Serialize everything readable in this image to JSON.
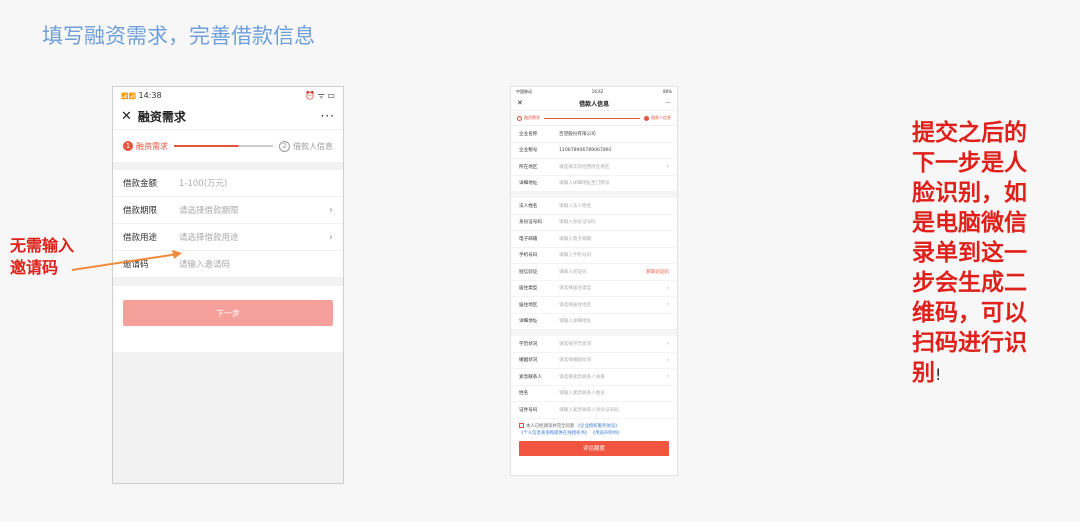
{
  "slide": {
    "title": "填写融资需求，完善借款信息"
  },
  "phone1": {
    "status": {
      "signal": "📶📶",
      "time": "14:38",
      "icons": "⏰ ᯤ ▭"
    },
    "nav": {
      "close": "✕",
      "title": "融资需求",
      "more": "···"
    },
    "steps": {
      "step1_num": "1",
      "step1_label": "融资需求",
      "step2_num": "2",
      "step2_label": "借款人信息"
    },
    "fields": [
      {
        "label": "借款金额",
        "value": "1-100(万元)"
      },
      {
        "label": "借款期限",
        "value": "请选择借款期限"
      },
      {
        "label": "借款用途",
        "value": "请选择借款用途"
      },
      {
        "label": "邀请码",
        "value": "请输入邀请码"
      }
    ],
    "chevron": "›",
    "next_button": "下一步"
  },
  "annotation_left": {
    "line1": "无需输入",
    "line2": "邀请码"
  },
  "phone2": {
    "status": {
      "carrier": "中国移动",
      "time": "16:42",
      "battery": "86%"
    },
    "nav": {
      "close": "✕",
      "title": "借款人信息",
      "more": "···"
    },
    "steps": {
      "step1": "融资需求",
      "step2": "借款人信息"
    },
    "group1": [
      {
        "label": "企业名称",
        "value": "百望股份有限公司"
      },
      {
        "label": "企业税号",
        "value": "110678906789067891"
      },
      {
        "label": "所在地区",
        "value": "请选择实际经营所在地区"
      },
      {
        "label": "详细地址",
        "value": "请输入详细地址至门牌号"
      }
    ],
    "group2": [
      {
        "label": "法人姓名",
        "value": "请输入法人姓名"
      },
      {
        "label": "身份证号码",
        "value": "请输入身份证号码"
      },
      {
        "label": "电子邮箱",
        "value": "请输入电子邮箱"
      },
      {
        "label": "手机号码",
        "value": "请输入手机号码"
      },
      {
        "label": "短信验证",
        "value": "请输入验证码",
        "action": "获取验证码"
      },
      {
        "label": "居住类型",
        "value": "请选择居住类型"
      },
      {
        "label": "居住地区",
        "value": "请选择居住地区"
      },
      {
        "label": "详细地址",
        "value": "请输入详细地址"
      }
    ],
    "group3": [
      {
        "label": "学历状况",
        "value": "请选择学历状况"
      },
      {
        "label": "婚姻状况",
        "value": "请选择婚姻状况"
      },
      {
        "label": "紧急联系人",
        "value": "请选择紧急联系人关系"
      },
      {
        "label": "姓名",
        "value": "请输入紧急联系人姓名"
      },
      {
        "label": "证件号码",
        "value": "请输入紧急联系人身份证号码"
      }
    ],
    "agreement": {
      "prefix": "本人已经阅读并完全同意",
      "link1": "《企业授权服务协议》",
      "link2": "《个人信息查询和提供在线授权书》",
      "link3": "《用途声明书》"
    },
    "submit_button": "评估额度",
    "chevron": "›"
  },
  "annotation_right": {
    "text": "提交之后的下一步是人脸识别，如是电脑微信录单到这一步会生成二维码，可以扫码进行识别",
    "end": "!"
  }
}
